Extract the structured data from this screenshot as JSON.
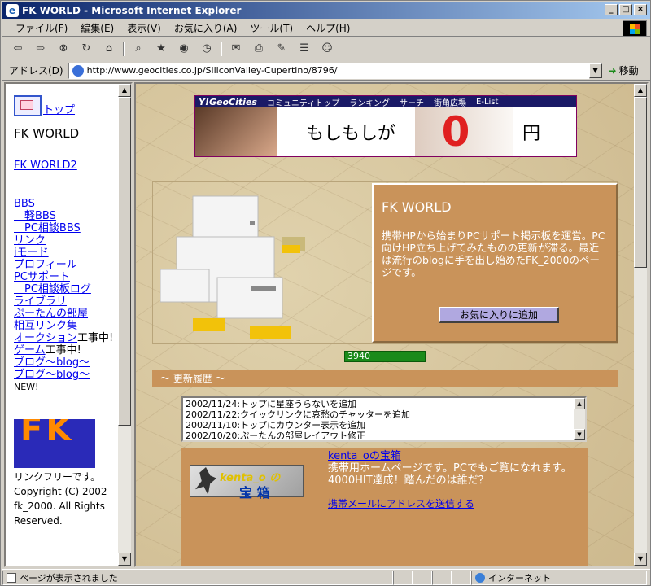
{
  "window": {
    "title": "FK WORLD - Microsoft Internet Explorer"
  },
  "menu": [
    "ファイル(F)",
    "編集(E)",
    "表示(V)",
    "お気に入り(A)",
    "ツール(T)",
    "ヘルプ(H)"
  ],
  "address": {
    "label": "アドレス(D)",
    "url": "http://www.geocities.co.jp/SiliconValley-Cupertino/8796/",
    "go": "移動"
  },
  "left": {
    "top_link": "トップ",
    "site_title": "FK WORLD",
    "fkworld2": "FK WORLD2",
    "links": [
      "BBS",
      "　軽BBS",
      "　PC相談BBS",
      "リンク",
      "iモード",
      "プロフィール",
      "PCサポート",
      "　PC相談板ログ",
      "ライブラリ",
      "ぷーたんの部屋",
      "相互リンク集",
      "オークション"
    ],
    "auction_note": "工事中!",
    "game": "ゲーム",
    "game_note": "工事中!",
    "blog1": "ブログ〜blog〜",
    "blog2": "ブログ〜blog〜",
    "new_note": "NEW!",
    "logo_text": "FK",
    "footer": "リンクフリーです。Copyright (C) 2002 fk_2000. All Rights Reserved."
  },
  "geocities": {
    "brand": "Y!GeoCities",
    "nav": [
      "コミュニティトップ",
      "ランキング",
      "サーチ",
      "街角広場",
      "E-List"
    ],
    "ad_text": "もしもしが",
    "ad_zero": "0",
    "ad_yen": "円"
  },
  "info": {
    "heading": "FK WORLD",
    "desc": "携帯HPから始まりPCサポート掲示板を運営。PC向けHP立ち上げてみたものの更新が滞る。最近は流行のblogに手を出し始めたFK_2000のページです。",
    "fav_button": "お気に入りに追加"
  },
  "counter": "3940",
  "history": {
    "heading": "〜 更新履歴 〜",
    "items": [
      "2002/11/24:トップに星座うらないを追加",
      "2002/11/22:クイックリンクに哀愁のチャッターを追加",
      "2002/11/10:トップにカウンター表示を追加",
      "2002/10/20:ぷーたんの部屋レイアウト修正"
    ]
  },
  "kenta": {
    "banner_top": "kenta_o",
    "banner_no": "の",
    "banner_bottom": "宝 箱",
    "title": "kenta_oの宝箱",
    "desc": "携帯用ホームページです。PCでもご覧になれます。4000HIT達成！踏んだのは誰だ？",
    "mail_link": "携帯メールにアドレスを送信する"
  },
  "status": {
    "left": "ページが表示されました",
    "zone": "インターネット"
  }
}
